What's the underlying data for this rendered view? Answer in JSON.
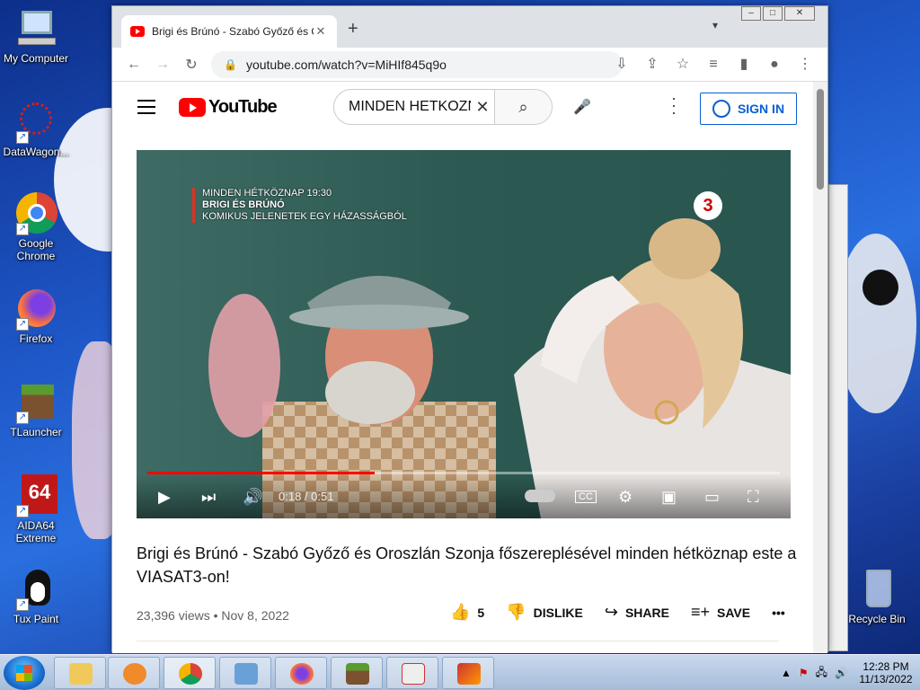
{
  "desktop": {
    "icons": [
      {
        "label": "My Computer"
      },
      {
        "label": "DataWagon..."
      },
      {
        "label": "Google Chrome"
      },
      {
        "label": "Firefox"
      },
      {
        "label": "TLauncher"
      },
      {
        "label": "AIDA64 Extreme"
      },
      {
        "label": "Tux Paint"
      },
      {
        "label": "Recycle Bin"
      }
    ]
  },
  "browser": {
    "tab_title": "Brigi és Brúnó - Szabó Győző és Oroszlán Szonja",
    "url": "youtube.com/watch?v=MiHIf845q9o"
  },
  "youtube": {
    "logo_text": "YouTube",
    "search_value": "MINDEN HETKOZNAP",
    "sign_in_label": "SIGN IN",
    "video": {
      "overlay_line1": "MINDEN HÉTKÖZNAP 19:30",
      "overlay_line2": "BRIGI ÉS BRÚNÓ",
      "overlay_line3": "KOMIKUS JELENETEK EGY HÁZASSÁGBÓL",
      "channel_badge": "3",
      "time": "0:18 / 0:51",
      "progress": 0.36
    },
    "title": "Brigi és Brúnó - Szabó Győző és Oroszlán Szonja főszereplésével minden hétköznap este a VIASAT3-on!",
    "views_date": "23,396 views • Nov 8, 2022",
    "likes": "5",
    "dislike_label": "DISLIKE",
    "share_label": "SHARE",
    "save_label": "SAVE"
  },
  "taskbar": {
    "time": "12:28 PM",
    "date": "11/13/2022"
  }
}
